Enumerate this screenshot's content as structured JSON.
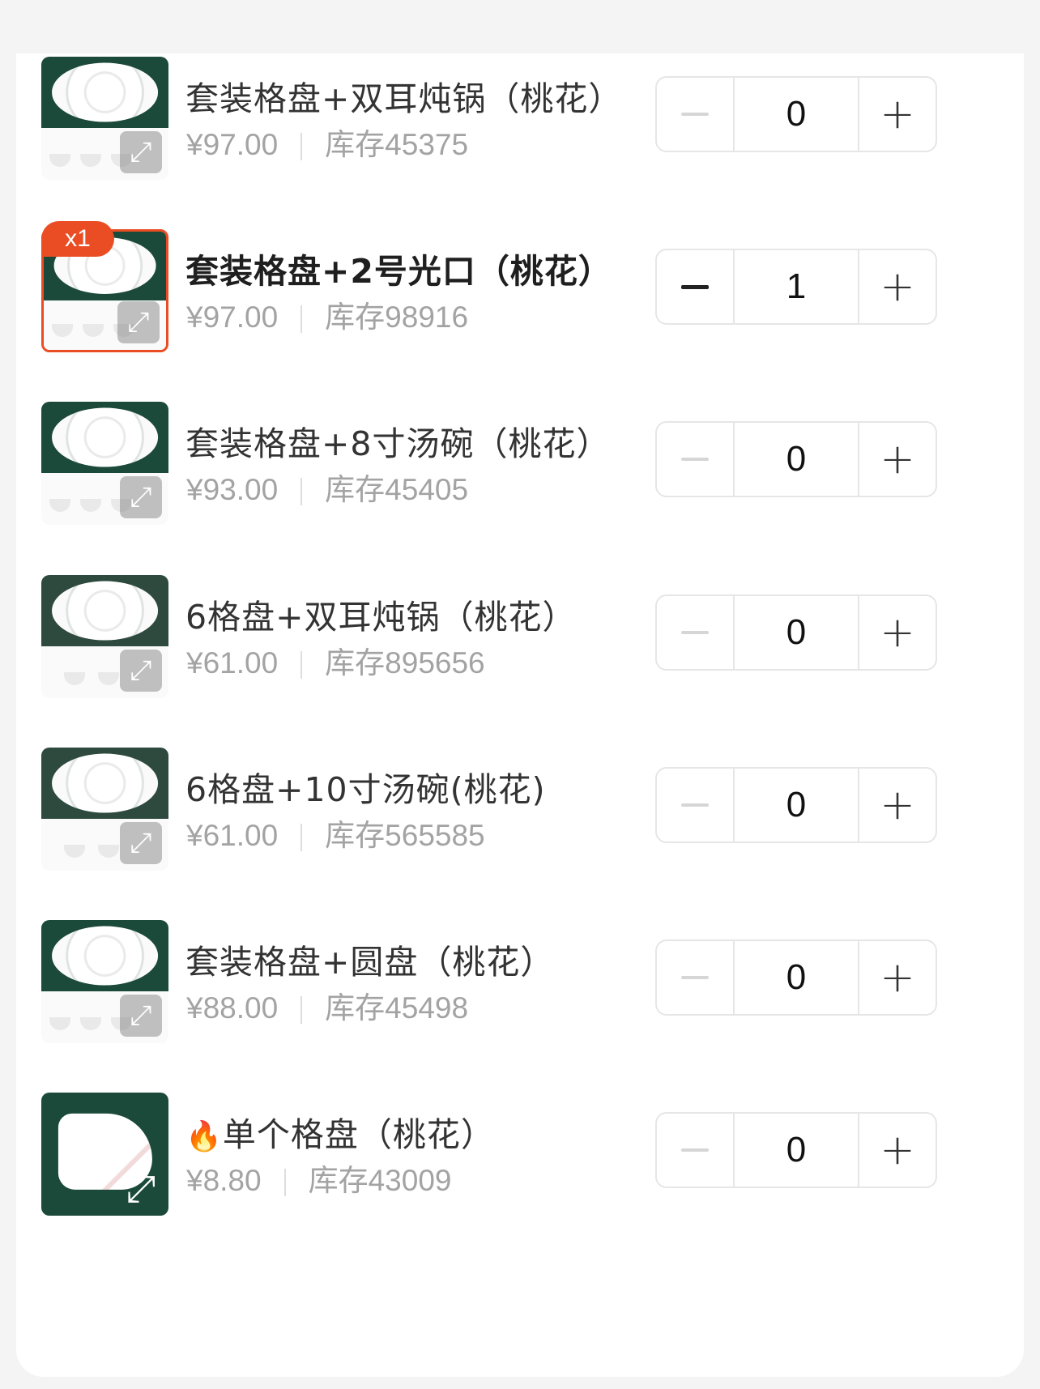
{
  "products": [
    {
      "title": "套装格盘+双耳炖锅（桃花）",
      "price": "¥97.00",
      "stock": "库存45375",
      "qty": "0",
      "selected": false,
      "badge": "",
      "hot": false
    },
    {
      "title": "套装格盘+2号光口（桃花）",
      "price": "¥97.00",
      "stock": "库存98916",
      "qty": "1",
      "selected": true,
      "badge": "x1",
      "hot": false
    },
    {
      "title": "套装格盘+8寸汤碗（桃花）",
      "price": "¥93.00",
      "stock": "库存45405",
      "qty": "0",
      "selected": false,
      "badge": "",
      "hot": false
    },
    {
      "title": "6格盘+双耳炖锅（桃花）",
      "price": "¥61.00",
      "stock": "库存895656",
      "qty": "0",
      "selected": false,
      "badge": "",
      "hot": false
    },
    {
      "title": "6格盘+10寸汤碗(桃花)",
      "price": "¥61.00",
      "stock": "库存565585",
      "qty": "0",
      "selected": false,
      "badge": "",
      "hot": false
    },
    {
      "title": "套装格盘+圆盘（桃花）",
      "price": "¥88.00",
      "stock": "库存45498",
      "qty": "0",
      "selected": false,
      "badge": "",
      "hot": false
    },
    {
      "title": "单个格盘（桃花）",
      "price": "¥8.80",
      "stock": "库存43009",
      "qty": "0",
      "selected": false,
      "badge": "",
      "hot": true
    }
  ],
  "labels": {
    "minus": "−",
    "plus": "+",
    "expand_icon": "⤢",
    "hot_icon": "🔥"
  },
  "colors": {
    "accent": "#ea4d24",
    "price": "#a3a3a3",
    "title": "#333333"
  }
}
